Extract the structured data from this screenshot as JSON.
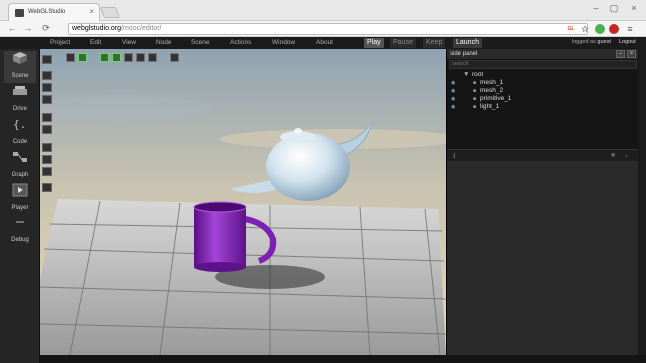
{
  "browser": {
    "tab_title": "WebGLStudio",
    "close_glyph": "×",
    "window_controls": [
      "–",
      "▢",
      "×"
    ],
    "back_glyph": "←",
    "forward_glyph": "→",
    "reload_glyph": "⟳",
    "url_domain": "webglstudio.org",
    "url_path": "/mooc/editor/",
    "extensions": [
      {
        "label": "GL",
        "color": "#e04a3a"
      },
      {
        "label": "☆",
        "color": "#888888"
      },
      {
        "label": "●",
        "color": "#4caf50"
      },
      {
        "label": "⬤",
        "color": "#607d8b"
      },
      {
        "label": "abp",
        "color": "#c62828"
      },
      {
        "label": "≡",
        "color": "#666666"
      }
    ]
  },
  "menu": {
    "items": [
      "Project",
      "Edit",
      "View",
      "Node",
      "Scene",
      "Actions",
      "Window",
      "About"
    ],
    "play": "Play",
    "pause": "Pause",
    "keep": "Keep",
    "launch": "Launch",
    "login_prefix": "logged as",
    "user": "guest",
    "logout": "Logout"
  },
  "sidebar": {
    "items": [
      {
        "label": "Scene",
        "icon": "cube-icon"
      },
      {
        "label": "Drive",
        "icon": "drive-icon"
      },
      {
        "label": "Code",
        "icon": "code-braces-icon"
      },
      {
        "label": "Graph",
        "icon": "graph-icon"
      },
      {
        "label": "Player",
        "icon": "play-icon"
      },
      {
        "label": "Debug",
        "icon": "debug-icon"
      }
    ]
  },
  "side_panel": {
    "title": "side panel",
    "search_placeholder": "search",
    "tree": [
      {
        "label": "root",
        "depth": 0,
        "expanded": true
      },
      {
        "label": "mesh_1",
        "depth": 1
      },
      {
        "label": "mesh_2",
        "depth": 1
      },
      {
        "label": "primitive_1",
        "depth": 1
      },
      {
        "label": "light_1",
        "depth": 1
      }
    ]
  },
  "colors": {
    "accent_green": "#6fd46f",
    "sky_top": "#8fa3b3",
    "teapot": "#d8e6ef",
    "mug": "#7d1fb0"
  }
}
